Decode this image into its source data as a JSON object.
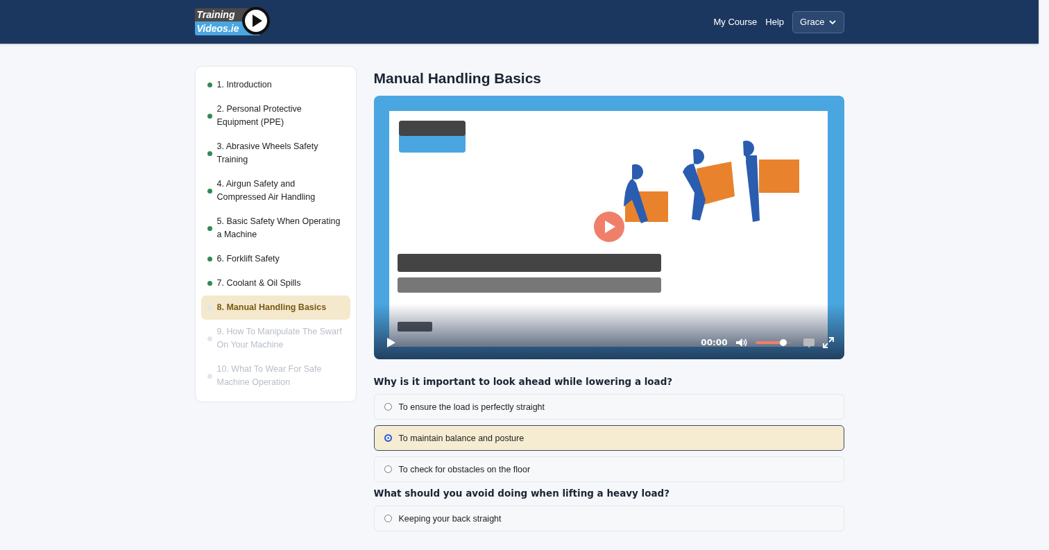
{
  "header": {
    "logo": {
      "line_1": "Training",
      "line_2": "Videos.ie"
    },
    "nav": [
      "My Course",
      "Help"
    ],
    "user_menu": {
      "label": "Grace"
    }
  },
  "sidebar": {
    "items": [
      {
        "label": "1. Introduction",
        "completed": true,
        "locked": false,
        "selected": false
      },
      {
        "label": "2. Personal Protective Equipment (PPE)",
        "completed": true,
        "locked": false,
        "selected": false
      },
      {
        "label": "3. Abrasive Wheels Safety Training",
        "completed": true,
        "locked": false,
        "selected": false
      },
      {
        "label": "4. Airgun Safety and Compressed Air Handling",
        "completed": true,
        "locked": false,
        "selected": false
      },
      {
        "label": "5. Basic Safety When Operating a Machine",
        "completed": true,
        "locked": false,
        "selected": false
      },
      {
        "label": "6. Forklift Safety",
        "completed": true,
        "locked": false,
        "selected": false
      },
      {
        "label": "7. Coolant & Oil Spills",
        "completed": true,
        "locked": false,
        "selected": false
      },
      {
        "label": "8. Manual Handling Basics",
        "completed": false,
        "locked": false,
        "selected": true
      },
      {
        "label": "9. How To Manipulate The Swarf On Your Machine",
        "completed": false,
        "locked": true,
        "selected": false
      },
      {
        "label": "10. What To Wear For Safe Machine Operation",
        "completed": false,
        "locked": true,
        "selected": false
      }
    ]
  },
  "lesson": {
    "title": "Manual Handling Basics",
    "video": {
      "kind": "picture",
      "time": "00:00",
      "volume": {
        "level": 0.78
      }
    },
    "questions": [
      {
        "text": "Why is it important to look ahead while lowering a load?",
        "options": [
          {
            "label": "To ensure the load is perfectly straight",
            "selected": false
          },
          {
            "label": "To maintain balance and posture",
            "selected": true
          },
          {
            "label": "To check for obstacles on the floor",
            "selected": false
          }
        ]
      },
      {
        "text": "What should you avoid doing when lifting a heavy load?",
        "options": [
          {
            "label": "Keeping your back straight",
            "selected": false
          }
        ]
      }
    ]
  }
}
